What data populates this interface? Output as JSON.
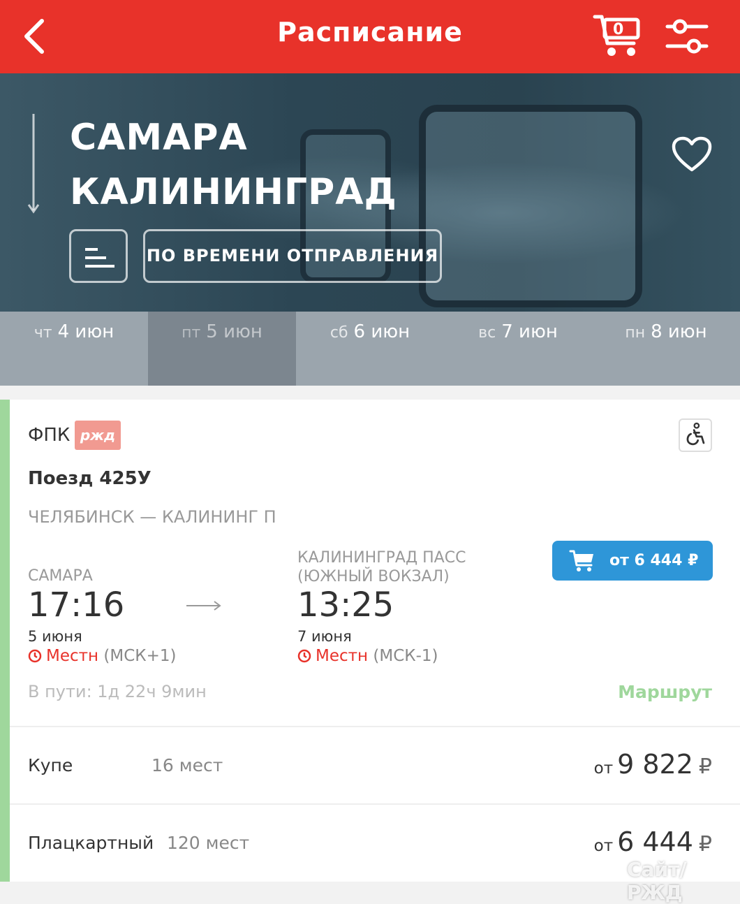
{
  "header": {
    "title": "Расписание",
    "cart_count": "0"
  },
  "hero": {
    "from": "САМАРА",
    "to": "КАЛИНИНГРАД",
    "sort_mode": "ПО ВРЕМЕНИ ОТПРАВЛЕНИЯ"
  },
  "dates": [
    {
      "dow": "чт",
      "date": "4 июн"
    },
    {
      "dow": "пт",
      "date": "5 июн"
    },
    {
      "dow": "сб",
      "date": "6 июн"
    },
    {
      "dow": "вс",
      "date": "7 июн"
    },
    {
      "dow": "пн",
      "date": "8 июн"
    }
  ],
  "selected_date_index": 1,
  "train": {
    "carrier": "ФПК",
    "carrier_logo": "ржд",
    "name": "Поезд 425У",
    "route": "ЧЕЛЯБИНСК — КАЛИНИНГ П",
    "price_button": "от 6 444 ₽",
    "departure": {
      "station": "САМАРА",
      "time": "17:16",
      "date": "5 июня",
      "tz_label": "Местн",
      "tz_offset": "(МСК+1)"
    },
    "arrival": {
      "station_line1": "КАЛИНИНГРАД ПАСС",
      "station_line2": "(ЮЖНЫЙ ВОКЗАЛ)",
      "time": "13:25",
      "date": "7 июня",
      "tz_label": "Местн",
      "tz_offset": "(МСК-1)"
    },
    "travel_time": "В пути: 1д 22ч 9мин",
    "route_link": "Маршрут",
    "classes": [
      {
        "name": "Купе",
        "seats": "16 мест",
        "prefix": "от",
        "price": "9 822",
        "currency": "₽"
      },
      {
        "name": "Плацкартный",
        "seats": "120 мест",
        "prefix": "от",
        "price": "6 444",
        "currency": "₽"
      }
    ]
  },
  "watermark": "Сайт/РЖД",
  "colors": {
    "header_red": "#e8322a",
    "accent_blue": "#2e96d8",
    "route_green": "#9fd79c"
  }
}
